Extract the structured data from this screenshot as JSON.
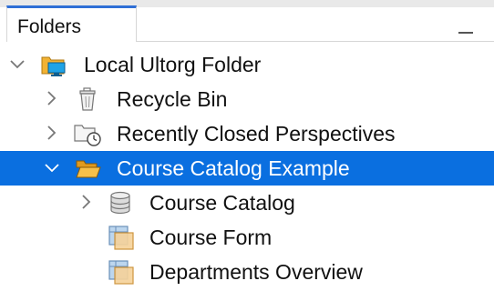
{
  "panel": {
    "tab_title": "Folders"
  },
  "tree": [
    {
      "label": "Local Ultorg Folder",
      "icon": "folder-with-computer-icon",
      "expanded": true,
      "selected": false
    },
    {
      "label": "Recycle Bin",
      "icon": "recycle-bin-icon",
      "expanded": false,
      "selected": false
    },
    {
      "label": "Recently Closed Perspectives",
      "icon": "recent-folder-clock-icon",
      "expanded": false,
      "selected": false
    },
    {
      "label": "Course Catalog Example",
      "icon": "folder-open-icon",
      "expanded": true,
      "selected": true
    },
    {
      "label": "Course Catalog",
      "icon": "database-icon",
      "expanded": false,
      "selected": false
    },
    {
      "label": "Course Form",
      "icon": "perspective-icon",
      "selected": false
    },
    {
      "label": "Departments Overview",
      "icon": "perspective-icon",
      "selected": false
    }
  ],
  "colors": {
    "selection": "#0a6fe0",
    "tab_accent": "#2f6fd6"
  }
}
